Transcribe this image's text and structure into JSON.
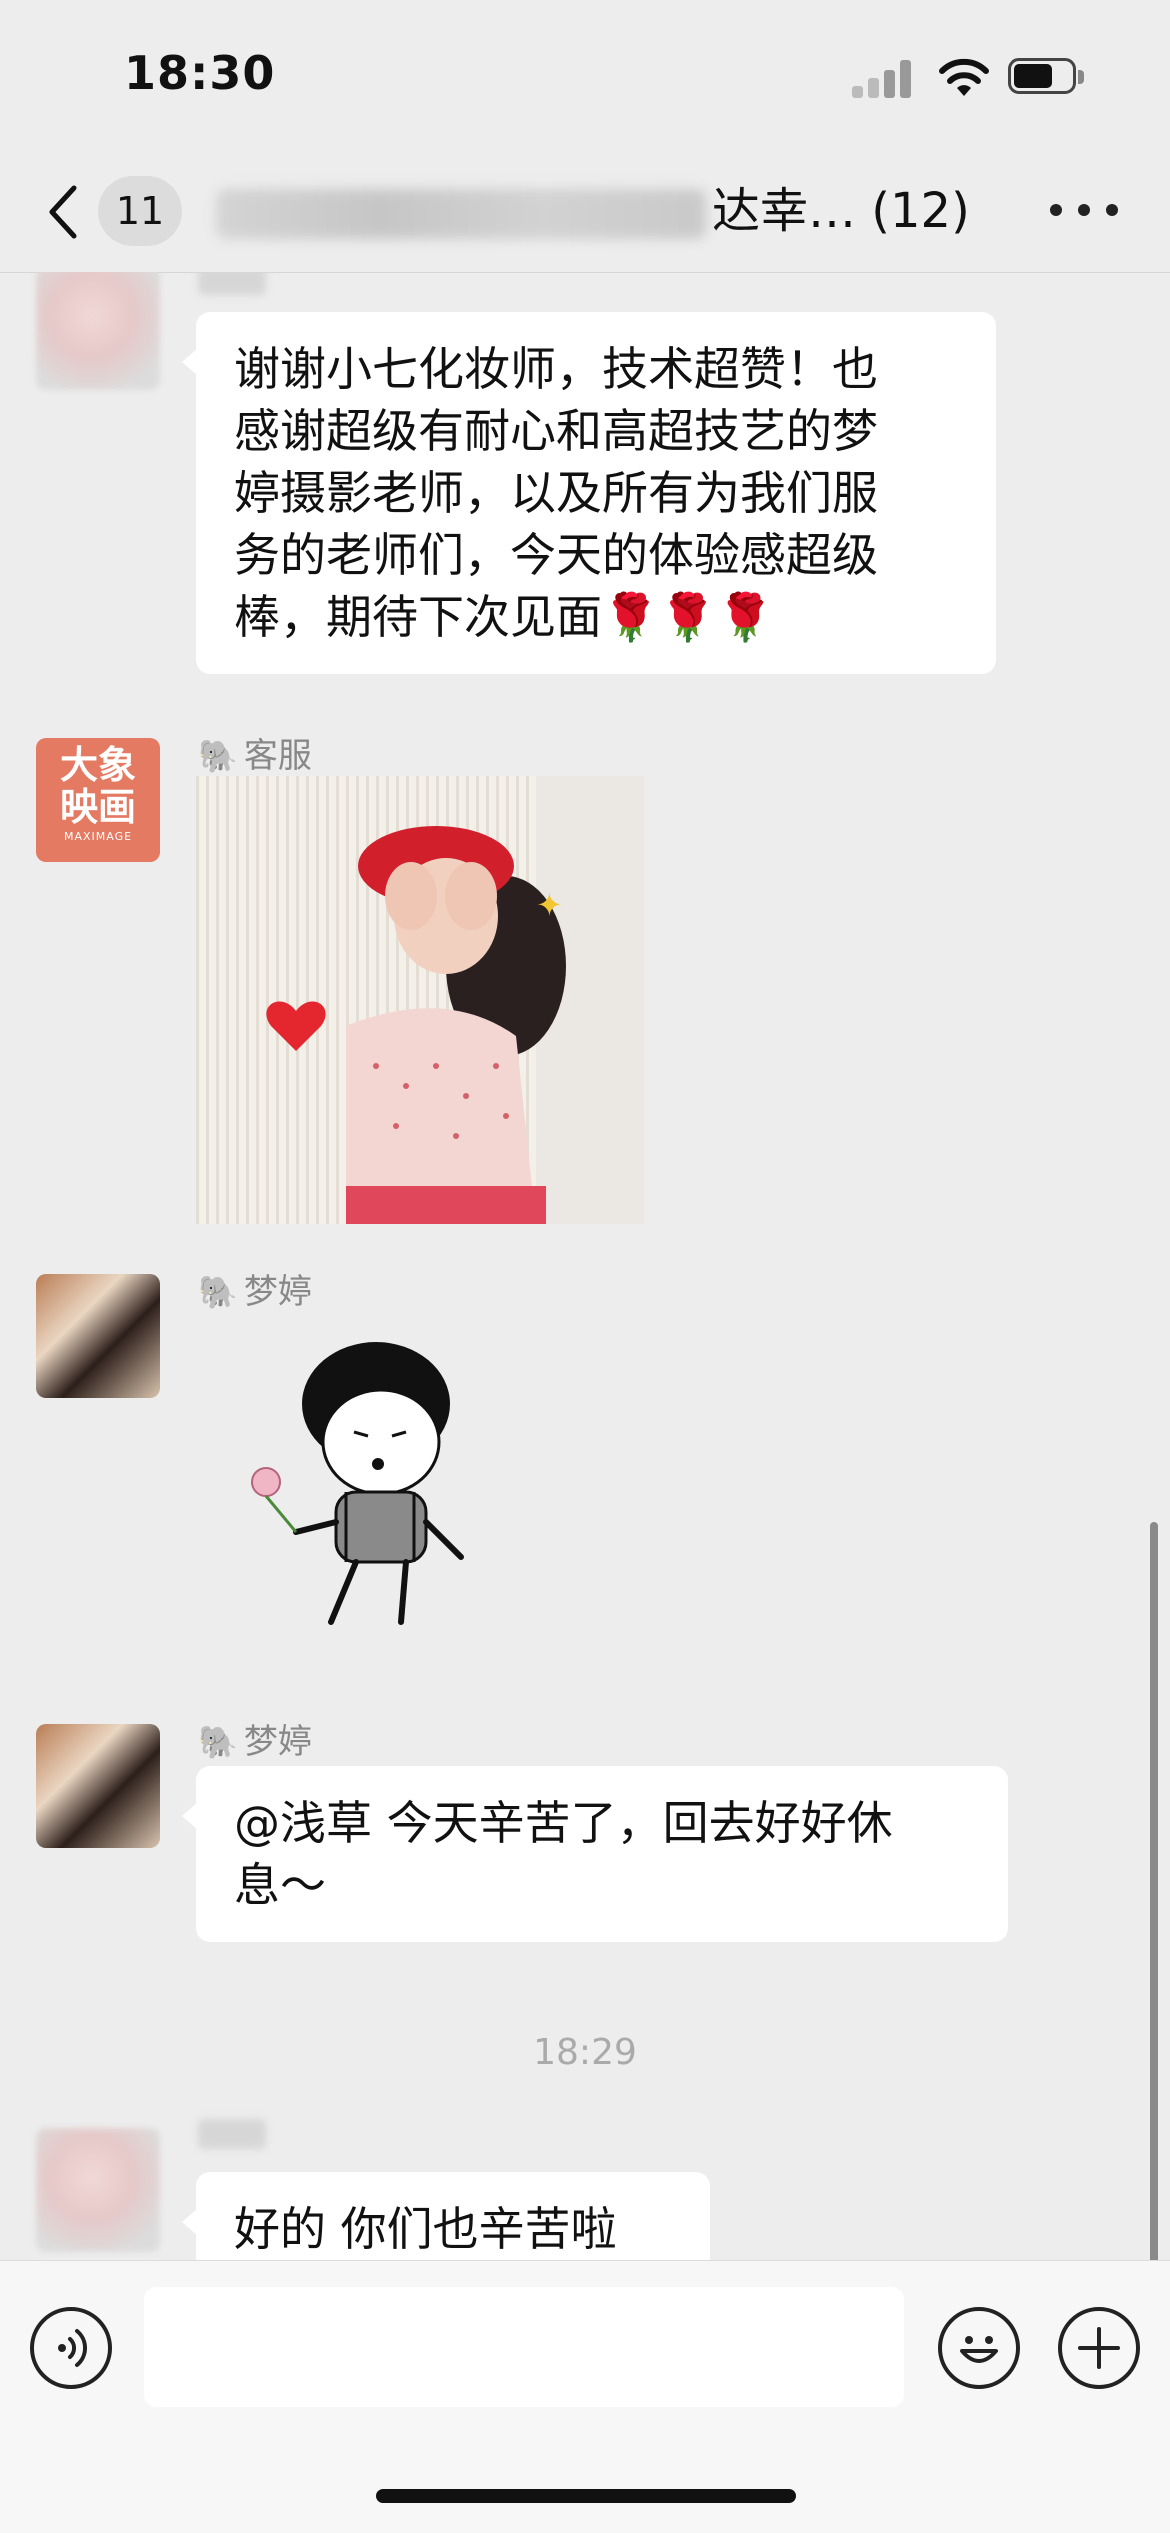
{
  "status_bar": {
    "time": "18:30"
  },
  "nav": {
    "back_count": "11",
    "title_visible": "达幸… (12)"
  },
  "messages": [
    {
      "sender": "",
      "type": "text",
      "text_lines": [
        "谢谢小七化妆师，技术超赞！也",
        "感谢超级有耐心和高超技艺的梦",
        "婷摄影老师，以及所有为我们服",
        "务的老师们，今天的体验感超级",
        "棒，期待下次见面🌹🌹🌹"
      ]
    },
    {
      "sender": "客服",
      "sender_icon": "elephant-icon",
      "avatar_text": "大象映画",
      "avatar_subtext": "MAXIMAGE",
      "type": "image"
    },
    {
      "sender": "梦婷",
      "sender_icon": "elephant-icon",
      "type": "sticker"
    },
    {
      "sender": "梦婷",
      "sender_icon": "elephant-icon",
      "type": "text",
      "text_lines": [
        "@浅草 今天辛苦了，回去好好休",
        "息～"
      ]
    },
    {
      "type": "timestamp",
      "text": "18:29"
    },
    {
      "sender": "",
      "type": "text",
      "text_lines": [
        "好的 你们也辛苦啦"
      ]
    }
  ],
  "input": {
    "value": "",
    "placeholder": ""
  },
  "colors": {
    "background": "#ededed",
    "bubble": "#ffffff",
    "logo": "#e57a63"
  }
}
